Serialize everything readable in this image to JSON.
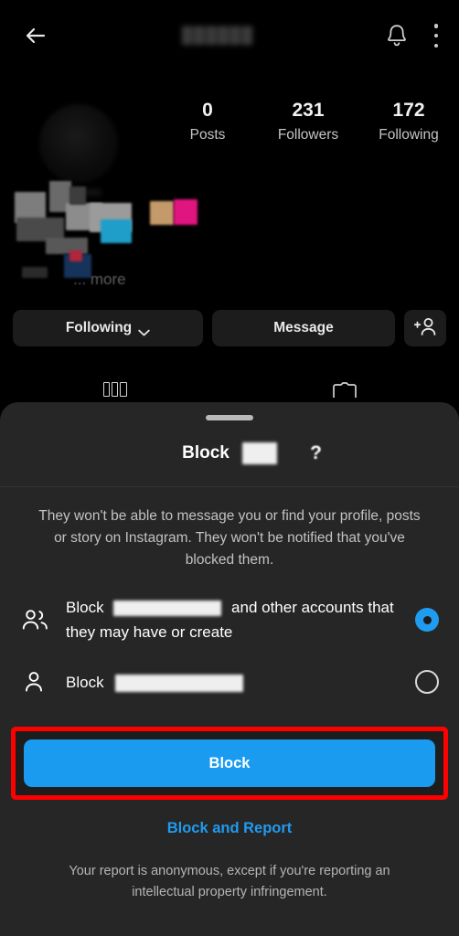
{
  "profile": {
    "topbar": {
      "back_icon": "arrow-left-icon",
      "username_redacted": "██████",
      "bell_icon": "bell-icon",
      "menu_icon": "overflow-menu-icon"
    },
    "stats": [
      {
        "value": "0",
        "label": "Posts"
      },
      {
        "value": "231",
        "label": "Followers"
      },
      {
        "value": "172",
        "label": "Following"
      }
    ],
    "bio_more": "... more",
    "actions": {
      "following_label": "Following",
      "message_label": "Message",
      "add_user_icon": "add-person-icon"
    },
    "tabs": [
      {
        "icon": "grid-tab-icon"
      },
      {
        "icon": "tagged-tab-icon"
      }
    ]
  },
  "sheet": {
    "title": "Block",
    "title_username_redacted": "",
    "help_icon": "question-mark-icon",
    "description": "They won't be able to message you or find your profile, posts or story on Instagram. They won't be notified that you've blocked them.",
    "options": [
      {
        "icon": "two-people-icon",
        "text_before": "Block",
        "text_after": "and other accounts that they may have or create",
        "selected": true
      },
      {
        "icon": "single-person-icon",
        "text_before": "Block",
        "text_after": "",
        "selected": false
      }
    ],
    "primary_button": "Block",
    "secondary_link": "Block and Report",
    "footnote": "Your report is anonymous, except if you're reporting an intellectual property infringement."
  },
  "colors": {
    "accent_blue": "#1a9bf0",
    "link_blue": "#1f9bf0",
    "highlight_red": "#ff0000",
    "sheet_bg": "#262626",
    "page_bg": "#000000"
  }
}
